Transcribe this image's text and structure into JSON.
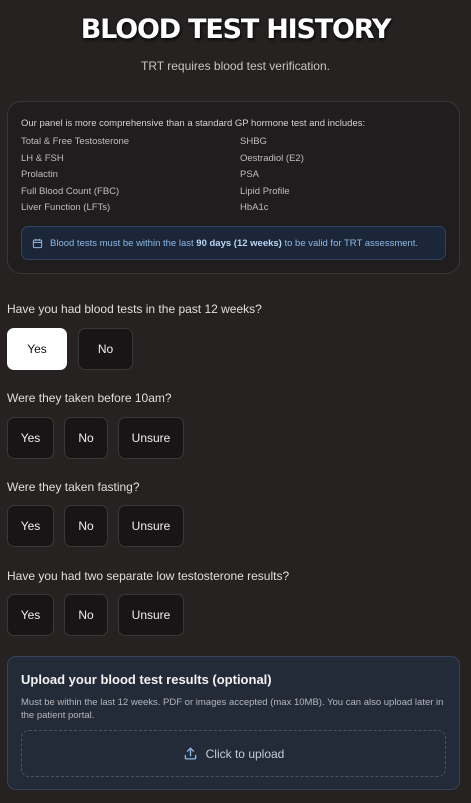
{
  "header": {
    "title": "BLOOD TEST HISTORY",
    "subtitle": "TRT requires blood test verification."
  },
  "panel": {
    "intro": "Our panel is more comprehensive than a standard GP hormone test and includes:",
    "tests": [
      "Total & Free Testosterone",
      "SHBG",
      "LH & FSH",
      "Oestradiol (E2)",
      "Prolactin",
      "PSA",
      "Full Blood Count (FBC)",
      "Lipid Profile",
      "Liver Function (LFTs)",
      "HbA1c"
    ],
    "notice": {
      "icon": "calendar-icon",
      "before": "Blood tests must be within the last ",
      "bold": "90 days (12 weeks)",
      "after": " to be valid for TRT assessment."
    }
  },
  "questions": [
    {
      "label": "Have you had blood tests in the past 12 weeks?",
      "options": [
        "Yes",
        "No"
      ],
      "selected": "Yes"
    },
    {
      "label": "Were they taken before 10am?",
      "options": [
        "Yes",
        "No",
        "Unsure"
      ],
      "selected": null
    },
    {
      "label": "Were they taken fasting?",
      "options": [
        "Yes",
        "No",
        "Unsure"
      ],
      "selected": null
    },
    {
      "label": "Have you had two separate low testosterone results?",
      "options": [
        "Yes",
        "No",
        "Unsure"
      ],
      "selected": null
    }
  ],
  "upload": {
    "title": "Upload your blood test results (optional)",
    "description": "Must be within the last 12 weeks. PDF or images accepted (max 10MB). You can also upload later in the patient portal.",
    "button_label": "Click to upload",
    "icon": "upload-icon"
  },
  "colors": {
    "background": "#262222",
    "notice_text": "#8fb8e6",
    "selected_button": "#ffffff",
    "upload_card": "#232a38"
  }
}
